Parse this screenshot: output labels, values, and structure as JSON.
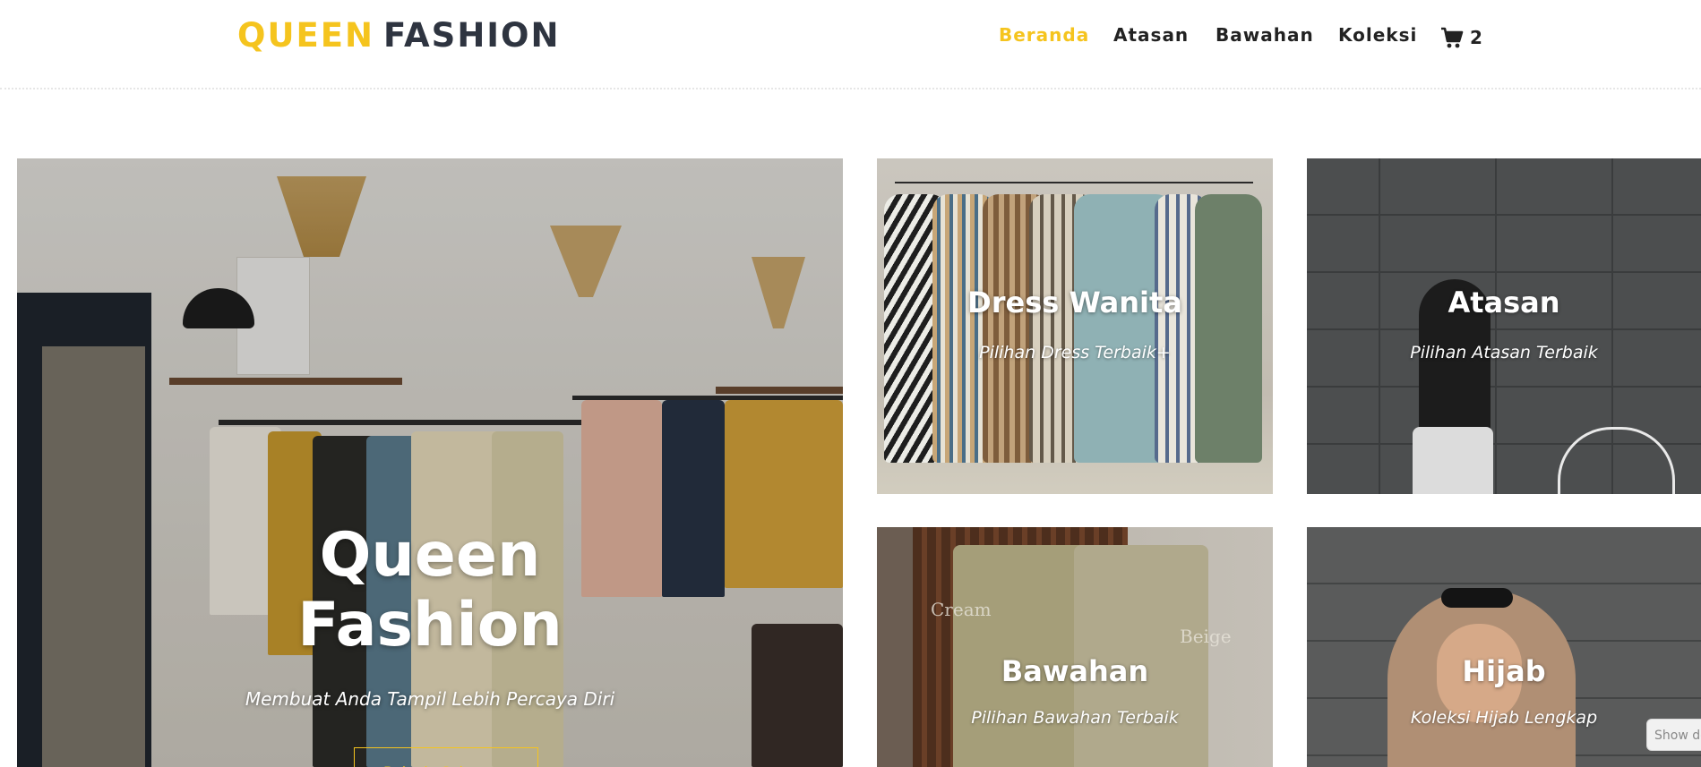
{
  "brand": {
    "part1": "QUEEN",
    "part2": "FASHION"
  },
  "nav": {
    "items": [
      {
        "label": "Beranda",
        "active": true
      },
      {
        "label": "Atasan",
        "active": false
      },
      {
        "label": "Bawahan",
        "active": false
      },
      {
        "label": "Koleksi",
        "active": false
      }
    ],
    "cart_icon": "shopping-cart-icon",
    "cart_count": "2"
  },
  "hero": {
    "title_line1": "Queen",
    "title_line2": "Fashion",
    "subtitle": "Membuat Anda Tampil Lebih Percaya Diri",
    "cta_label": "Belanja Sekarang"
  },
  "categories": [
    {
      "title": "Dress Wanita",
      "subtitle": "Pilihan Dress Terbaik+"
    },
    {
      "title": "Atasan",
      "subtitle": "Pilihan Atasan Terbaik"
    },
    {
      "title": "Bawahan",
      "subtitle": "Pilihan Bawahan Terbaik"
    },
    {
      "title": "Hijab",
      "subtitle": "Koleksi Hijab Lengkap"
    }
  ],
  "bawahan_photo_labels": {
    "left": "Cream",
    "right": "Beige"
  },
  "show_tab_label": "Show de",
  "colors": {
    "accent": "#f5c41e",
    "text_dark": "#2e3440"
  }
}
